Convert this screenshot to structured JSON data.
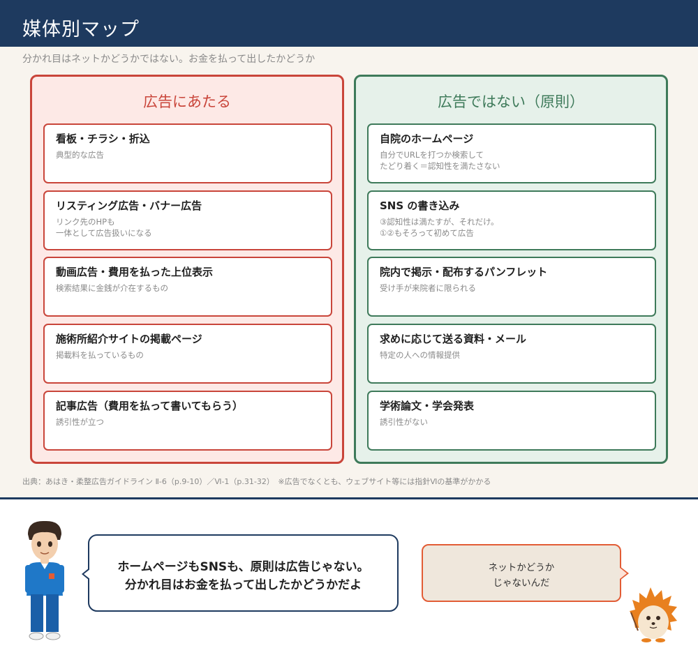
{
  "header": {
    "title": "媒体別マップ"
  },
  "subtitle": "分かれ目はネットかどうかではない。お金を払って出したかどうか",
  "left_panel": {
    "title": "広告にあたる",
    "cards": [
      {
        "title": "看板・チラシ・折込",
        "desc": [
          "典型的な広告"
        ]
      },
      {
        "title": "リスティング広告・バナー広告",
        "desc": [
          "リンク先のHPも",
          "一体として広告扱いになる"
        ]
      },
      {
        "title": "動画広告・費用を払った上位表示",
        "desc": [
          "検索結果に金銭が介在するもの"
        ]
      },
      {
        "title": "施術所紹介サイトの掲載ページ",
        "desc": [
          "掲載料を払っているもの"
        ]
      },
      {
        "title": "記事広告（費用を払って書いてもらう）",
        "desc": [
          "誘引性が立つ"
        ]
      }
    ]
  },
  "right_panel": {
    "title": "広告ではない（原則）",
    "cards": [
      {
        "title": "自院のホームページ",
        "desc": [
          "自分でURLを打つか検索して",
          "たどり着く＝認知性を満たさない"
        ]
      },
      {
        "title": "SNS の書き込み",
        "desc": [
          "③認知性は満たすが、それだけ。",
          "①②もそろって初めて広告"
        ]
      },
      {
        "title": "院内で掲示・配布するパンフレット",
        "desc": [
          "受け手が来院者に限られる"
        ]
      },
      {
        "title": "求めに応じて送る資料・メール",
        "desc": [
          "特定の人への情報提供"
        ]
      },
      {
        "title": "学術論文・学会発表",
        "desc": [
          "誘引性がない"
        ]
      }
    ]
  },
  "source": "出典：あはき・柔整広告ガイドライン Ⅱ-6（p.9-10）／Ⅵ-1（p.31-32）　※広告でなくとも、ウェブサイト等には指針Ⅵの基準がかかる",
  "speech_main": [
    "ホームページもSNSも、原則は広告じゃない。",
    "分かれ目はお金を払って出したかどうかだよ"
  ],
  "speech_side": [
    "ネットかどうか",
    "じゃないんだ"
  ],
  "colors": {
    "navy": "#1e3a5f",
    "red": "#c9453a",
    "green": "#3e7a5a",
    "orange": "#e25c35",
    "background": "#f8f4ee"
  }
}
